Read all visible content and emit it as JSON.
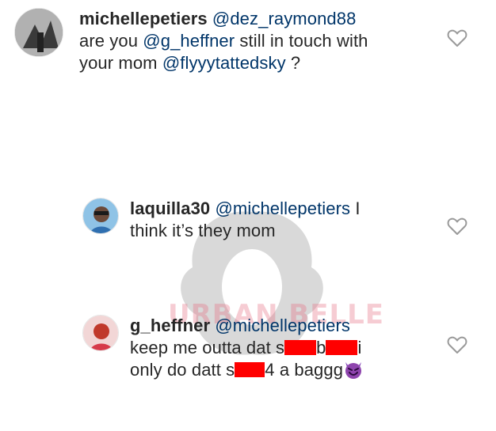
{
  "comments": [
    {
      "username": "michellepetiers",
      "mention1": "@dez_raymond88",
      "line2_a": "are you ",
      "mention2": "@g_heffner",
      "line2_b": " still in touch with",
      "line3_a": "your mom ",
      "mention3": "@flyyytattedsky",
      "line3_b": " ?",
      "avatar": "avatar-image",
      "like_icon": "heart-outline-icon"
    },
    {
      "username": "laquilla30",
      "mention1": "@michellepetiers",
      "line1_b": " I",
      "line2": "think it’s they mom",
      "avatar": "avatar-image",
      "like_icon": "heart-outline-icon"
    },
    {
      "username": "g_heffner",
      "mention1": "@michellepetiers",
      "line2_a": "keep me outta dat s",
      "line2_b": "b",
      "line2_c": "i",
      "line3_a": "only do datt s",
      "line3_b": "4 a baggg",
      "emoji": "smiling-devil-emoji",
      "avatar": "avatar-image",
      "like_icon": "heart-outline-icon"
    }
  ],
  "watermark": {
    "text": "URBAN BELLE"
  },
  "colors": {
    "mention": "#003569",
    "text": "#262626",
    "redaction": "#ff0000",
    "heart_stroke": "#999999"
  }
}
